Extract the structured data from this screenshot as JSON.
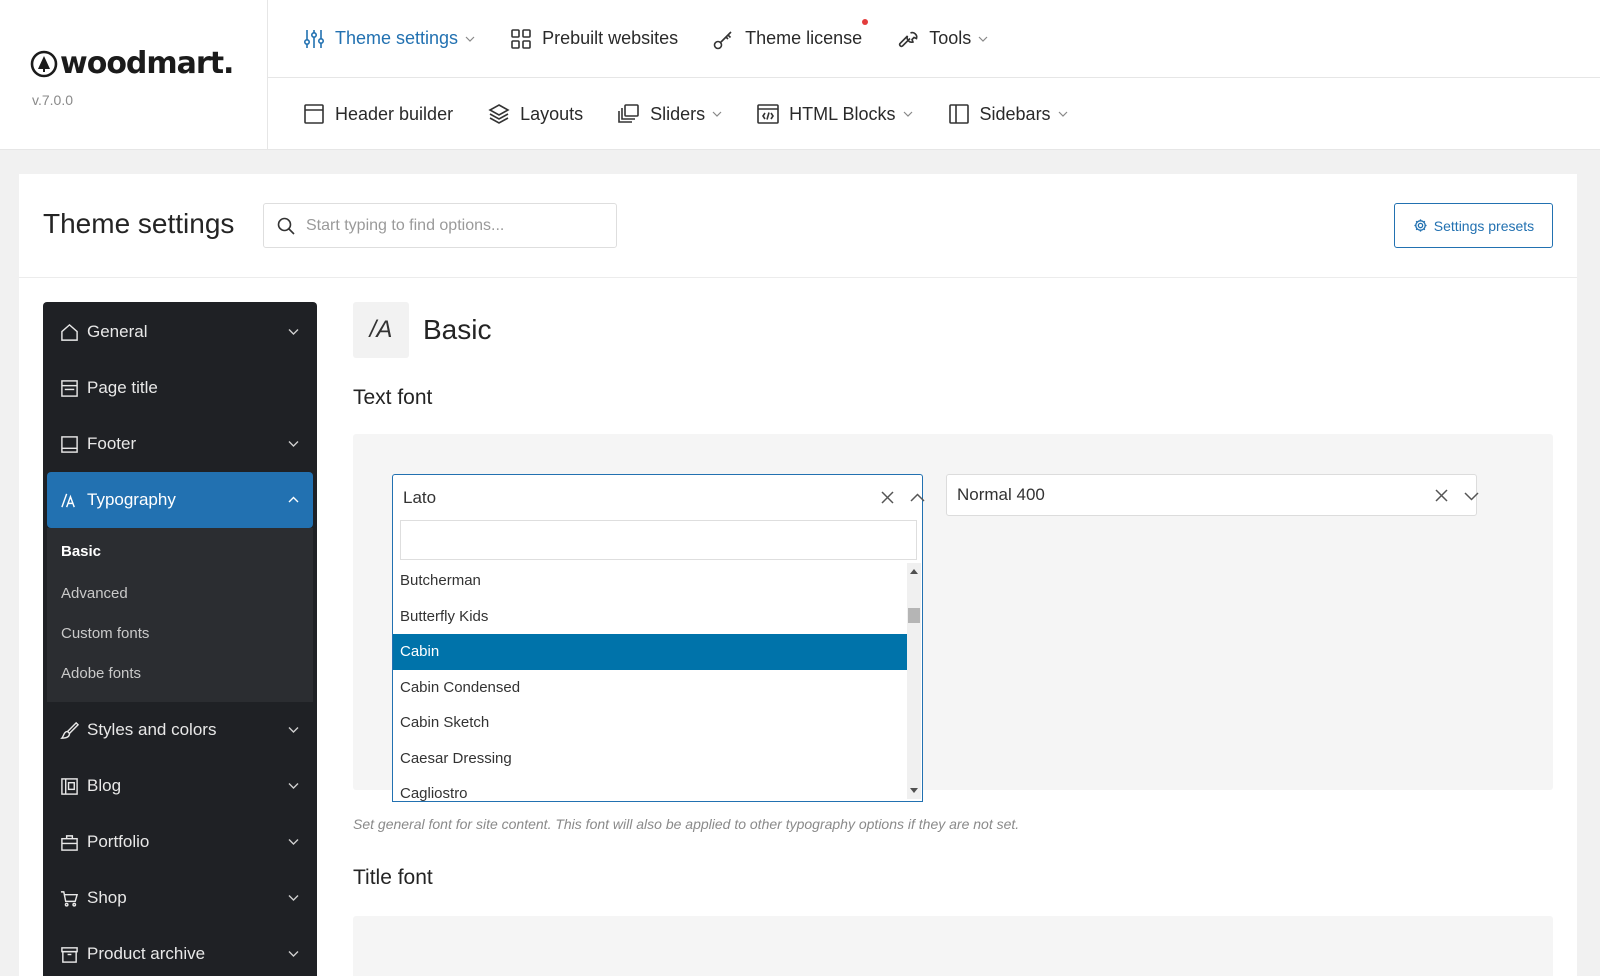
{
  "brand": {
    "name": "woodmart.",
    "version": "v.7.0.0"
  },
  "topnav": [
    {
      "label": "Theme settings",
      "icon": "sliders-icon",
      "caret": true,
      "active": true
    },
    {
      "label": "Prebuilt websites",
      "icon": "grid-icon",
      "caret": false
    },
    {
      "label": "Theme license",
      "icon": "key-icon",
      "caret": false,
      "notify": true
    },
    {
      "label": "Tools",
      "icon": "wrench-icon",
      "caret": true
    }
  ],
  "subnav": [
    {
      "label": "Header builder",
      "icon": "header-icon",
      "caret": false
    },
    {
      "label": "Layouts",
      "icon": "layers-icon",
      "caret": false
    },
    {
      "label": "Sliders",
      "icon": "slides-icon",
      "caret": true
    },
    {
      "label": "HTML Blocks",
      "icon": "code-window-icon",
      "caret": true
    },
    {
      "label": "Sidebars",
      "icon": "sidebar-icon",
      "caret": true
    }
  ],
  "page": {
    "title": "Theme settings",
    "search_placeholder": "Start typing to find options...",
    "presets_label": "Settings presets"
  },
  "sidebar": {
    "items_top": [
      {
        "label": "General",
        "icon": "home-icon",
        "chevron": true
      },
      {
        "label": "Page title",
        "icon": "page-icon",
        "chevron": false
      },
      {
        "label": "Footer",
        "icon": "footer-icon",
        "chevron": true
      }
    ],
    "active": {
      "label": "Typography",
      "icon": "typography-icon"
    },
    "sub_items": [
      "Basic",
      "Advanced",
      "Custom fonts",
      "Adobe fonts"
    ],
    "sub_active": "Basic",
    "items_bottom": [
      {
        "label": "Styles and colors",
        "icon": "brush-icon"
      },
      {
        "label": "Blog",
        "icon": "blog-icon"
      },
      {
        "label": "Portfolio",
        "icon": "briefcase-icon"
      },
      {
        "label": "Shop",
        "icon": "cart-icon"
      },
      {
        "label": "Product archive",
        "icon": "archive-icon"
      }
    ]
  },
  "section": {
    "title": "Basic",
    "icon_text": "/A"
  },
  "text_font": {
    "label": "Text font",
    "family": "Lato",
    "weight": "Normal 400",
    "search_value": "",
    "options": [
      "Butcherman",
      "Butterfly Kids",
      "Cabin",
      "Cabin Condensed",
      "Cabin Sketch",
      "Caesar Dressing",
      "Cagliostro"
    ],
    "selected": "Cabin",
    "description": "Set general font for site content. This font will also be applied to other typography options if they are not set."
  },
  "title_font": {
    "label": "Title font"
  },
  "colors": {
    "accent": "#2271b1",
    "sidebar_bg": "#1f2125",
    "selected_option": "#0073aa"
  }
}
